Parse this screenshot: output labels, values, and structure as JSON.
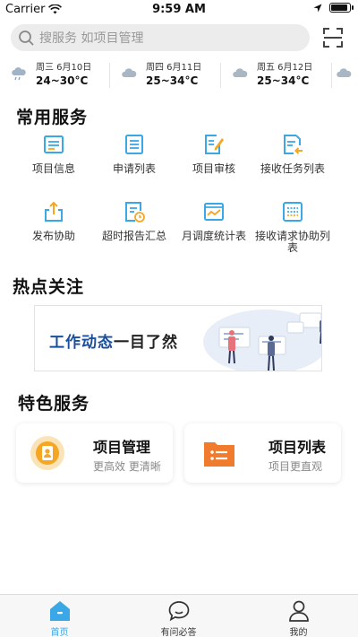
{
  "status_bar": {
    "carrier": "Carrier",
    "time": "9:59 AM"
  },
  "search": {
    "placeholder": "搜服务 如项目管理"
  },
  "weather": [
    {
      "date": "周三 6月10日",
      "temp": "24~30°C"
    },
    {
      "date": "周四 6月11日",
      "temp": "25~34°C"
    },
    {
      "date": "周五 6月12日",
      "temp": "25~34°C"
    }
  ],
  "common_services": {
    "title": "常用服务",
    "items": [
      {
        "label": "项目信息",
        "icon": "doc-list-icon"
      },
      {
        "label": "申请列表",
        "icon": "list-icon"
      },
      {
        "label": "项目审核",
        "icon": "doc-edit-icon"
      },
      {
        "label": "接收任务列表",
        "icon": "task-receive-icon"
      },
      {
        "label": "发布协助",
        "icon": "upload-icon"
      },
      {
        "label": "超时报告汇总",
        "icon": "report-clock-icon"
      },
      {
        "label": "月调度统计表",
        "icon": "chart-icon"
      },
      {
        "label": "接收请求协助列表",
        "icon": "inbox-list-icon"
      }
    ]
  },
  "hot_topics": {
    "title": "热点关注",
    "banner": {
      "text_main": "工作动态",
      "text_accent": "一目了然"
    }
  },
  "featured_services": {
    "title": "特色服务",
    "cards": [
      {
        "title": "项目管理",
        "subtitle": "更高效 更清晰",
        "icon": "user-badge-icon",
        "color": "#f5a623"
      },
      {
        "title": "项目列表",
        "subtitle": "项目更直观",
        "icon": "folder-list-icon",
        "color": "#f07b2c"
      }
    ]
  },
  "tab_bar": {
    "items": [
      {
        "label": "首页",
        "icon": "home-icon",
        "active": true
      },
      {
        "label": "有问必答",
        "icon": "chat-icon",
        "active": false
      },
      {
        "label": "我的",
        "icon": "person-icon",
        "active": false
      }
    ]
  },
  "colors": {
    "accent": "#3aa8e6",
    "icon_blue": "#3aa8e6",
    "icon_orange": "#f5a623"
  }
}
